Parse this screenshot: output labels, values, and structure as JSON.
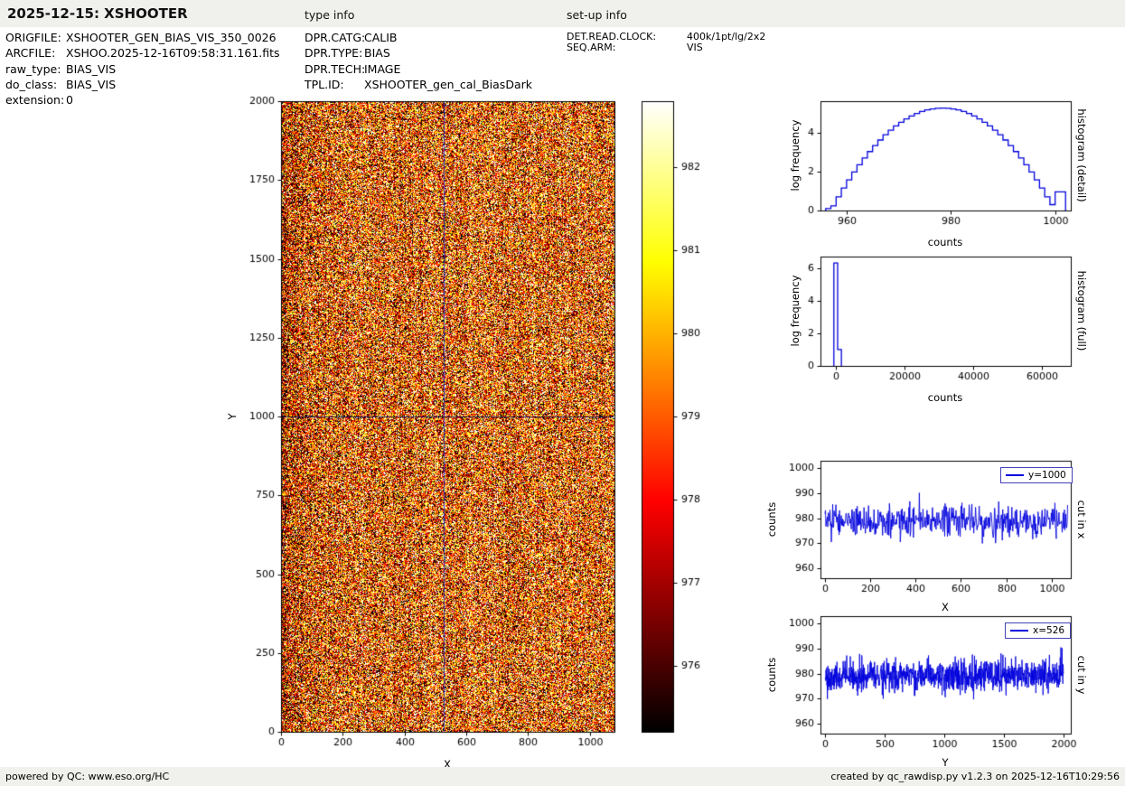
{
  "header": {
    "title": "2025-12-15: XSHOOTER",
    "type_info_heading": "type info",
    "setup_info_heading": "set-up info"
  },
  "file_info": {
    "rows": [
      {
        "key": "ORIGFILE:",
        "value": "XSHOOTER_GEN_BIAS_VIS_350_0026"
      },
      {
        "key": "ARCFILE:",
        "value": "XSHOO.2025-12-16T09:58:31.161.fits"
      },
      {
        "key": "raw_type:",
        "value": "BIAS_VIS"
      },
      {
        "key": "do_class:",
        "value": "BIAS_VIS"
      },
      {
        "key": "extension:",
        "value": "0"
      }
    ]
  },
  "type_info": {
    "rows": [
      {
        "key": "DPR.CATG:",
        "value": "CALIB"
      },
      {
        "key": "DPR.TYPE:",
        "value": "BIAS"
      },
      {
        "key": "DPR.TECH:",
        "value": "IMAGE"
      },
      {
        "key": "TPL.ID:",
        "value": "XSHOOTER_gen_cal_BiasDark"
      }
    ]
  },
  "setup_info": {
    "rows": [
      {
        "key": "DET.READ.CLOCK:",
        "value": "400k/1pt/lg/2x2"
      },
      {
        "key": "SEQ.ARM:",
        "value": "VIS"
      }
    ]
  },
  "footer": {
    "left": "powered by QC: www.eso.org/HC",
    "right": "created by qc_rawdisp.py v1.2.3 on 2025-12-16T10:29:56"
  },
  "colors": {
    "plot_blue": "#0000dd",
    "crosshair_vertical": "#3434b4",
    "crosshair_horizontal": "#16164f",
    "bar_background": "#f0f0ed",
    "colormap": "hot"
  },
  "chart_data": [
    {
      "id": "bias_image",
      "type": "heatmap",
      "description": "raw bias frame, gaussian noise around 979 counts shown with hot colormap",
      "xlabel": "X",
      "ylabel": "Y",
      "xlim": [
        0,
        1080
      ],
      "ylim": [
        0,
        2000
      ],
      "xticks": [
        0,
        200,
        400,
        600,
        800,
        1000
      ],
      "yticks": [
        0,
        250,
        500,
        750,
        1000,
        1250,
        1500,
        1750,
        2000
      ],
      "vmin": 975.2,
      "vmax": 982.8,
      "noise": {
        "mean": 979.0,
        "sigma": 3.0
      },
      "crosshair": {
        "x": 526,
        "y": 1000
      }
    },
    {
      "id": "colorbar",
      "type": "colorbar",
      "vmin": 975.2,
      "vmax": 982.8,
      "ticks": [
        976,
        977,
        978,
        979,
        980,
        981,
        982
      ]
    },
    {
      "id": "hist_detail",
      "type": "histogram",
      "xlabel": "counts",
      "ylabel": "log frequency",
      "side_label": "histogram (detail)",
      "xlim": [
        955,
        1003
      ],
      "ylim": [
        0,
        5.6
      ],
      "xticks": [
        960,
        980,
        1000
      ],
      "yticks": [
        0,
        2,
        4
      ],
      "bin_start": 956,
      "bin_width": 1,
      "log_frequency": [
        0.1,
        0.24,
        0.7,
        1.15,
        1.57,
        1.97,
        2.34,
        2.69,
        3.02,
        3.33,
        3.61,
        3.88,
        4.11,
        4.33,
        4.52,
        4.69,
        4.84,
        4.97,
        5.07,
        5.15,
        5.2,
        5.24,
        5.25,
        5.24,
        5.2,
        5.15,
        5.07,
        4.97,
        4.84,
        4.69,
        4.52,
        4.33,
        4.11,
        3.88,
        3.61,
        3.33,
        3.02,
        2.69,
        2.34,
        1.97,
        1.57,
        1.15,
        0.7,
        0.3,
        0.95,
        0.95
      ]
    },
    {
      "id": "hist_full",
      "type": "histogram",
      "xlabel": "counts",
      "ylabel": "log frequency",
      "side_label": "histogram (full)",
      "xlim": [
        -4500,
        68500
      ],
      "ylim": [
        0,
        6.7
      ],
      "xticks": [
        0,
        20000,
        40000,
        60000
      ],
      "yticks": [
        0,
        2,
        4,
        6
      ],
      "bin_start": -600,
      "bin_width": 1100,
      "log_frequency": [
        6.3,
        1.0
      ]
    },
    {
      "id": "cut_x",
      "type": "line",
      "xlabel": "X",
      "ylabel": "counts",
      "side_label": "cut in x",
      "legend": "y=1000",
      "xlim": [
        -20,
        1085
      ],
      "ylim": [
        956,
        1003
      ],
      "xticks": [
        0,
        200,
        400,
        600,
        800,
        1000
      ],
      "yticks": [
        960,
        970,
        980,
        990,
        1000
      ],
      "series": {
        "mean": 979.0,
        "sigma": 3.2,
        "n_points": 536,
        "x_start": 0,
        "x_end": 1071
      }
    },
    {
      "id": "cut_y",
      "type": "line",
      "xlabel": "Y",
      "ylabel": "counts",
      "side_label": "cut in y",
      "legend": "x=526",
      "xlim": [
        -40,
        2060
      ],
      "ylim": [
        956,
        1003
      ],
      "xticks": [
        0,
        500,
        1000,
        1500,
        2000
      ],
      "yticks": [
        960,
        970,
        980,
        990,
        1000
      ],
      "series": {
        "mean": 979.0,
        "sigma": 3.2,
        "n_points": 1000,
        "x_start": 0,
        "x_end": 1999
      }
    }
  ]
}
